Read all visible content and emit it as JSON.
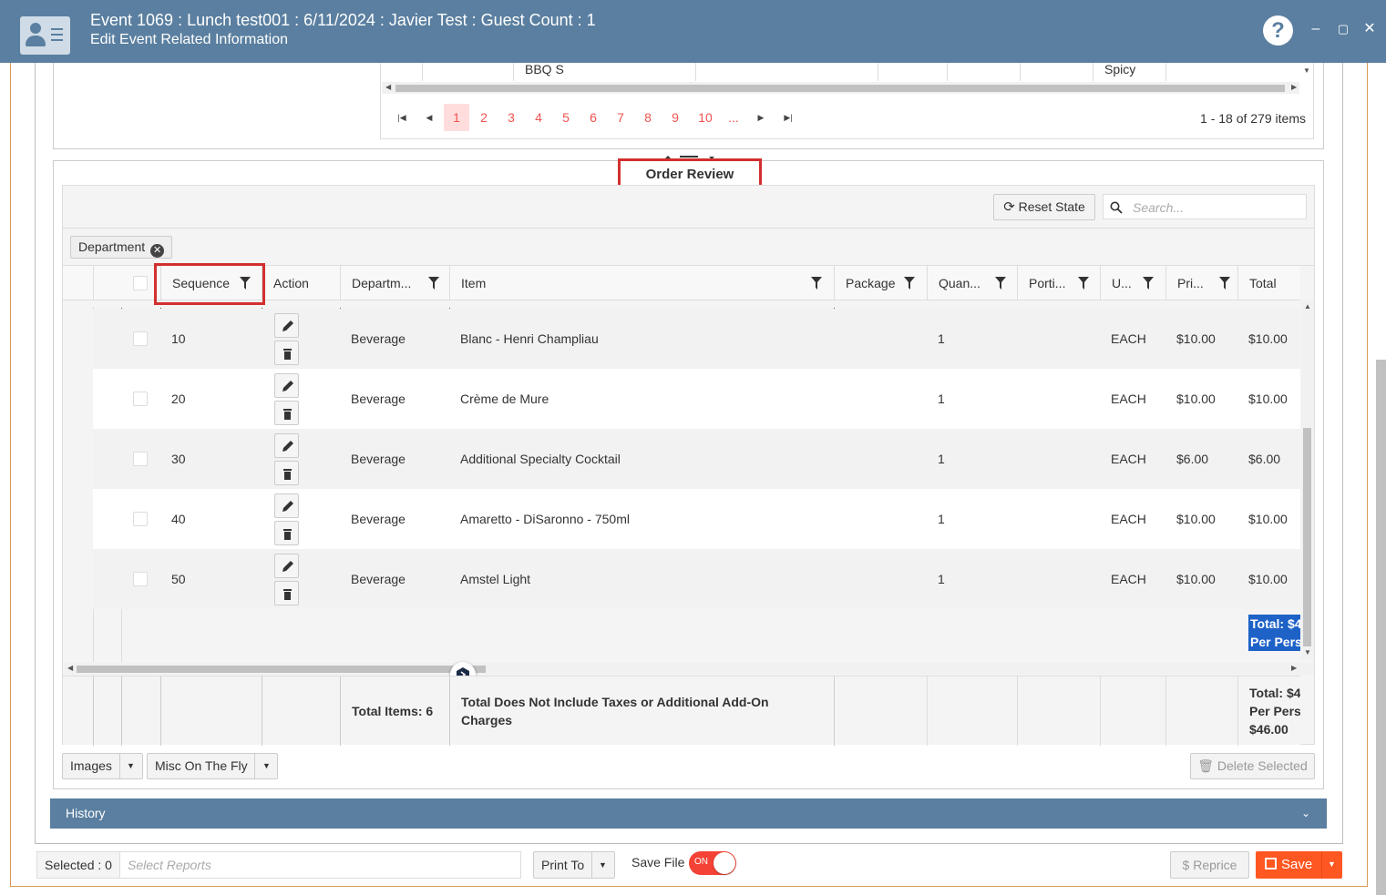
{
  "window": {
    "title": "Event 1069 : Lunch test001 : 6/11/2024 : Javier Test : Guest Count : 1",
    "subtitle": "Edit Event Related Information",
    "help_label": "?",
    "minimize": "–",
    "maximize": "▢",
    "close": "✕"
  },
  "top_grid": {
    "row": {
      "item": "BBQ S",
      "note": "Spicy"
    },
    "pager": {
      "pages": [
        "1",
        "2",
        "3",
        "4",
        "5",
        "6",
        "7",
        "8",
        "9",
        "10",
        "..."
      ],
      "active_page": "1",
      "info": "1 - 18 of 279 items"
    }
  },
  "order_review": {
    "title": "Order Review",
    "reset_state_label": "Reset State",
    "search_placeholder": "Search...",
    "group_chip": "Department",
    "columns": {
      "sequence": "Sequence",
      "action": "Action",
      "department": "Departm...",
      "item": "Item",
      "package": "Package",
      "quantity": "Quan...",
      "portion": "Porti...",
      "unit": "U...",
      "price": "Pri...",
      "total": "Total"
    },
    "rows": [
      {
        "sequence": "10",
        "department": "Beverage",
        "item": "Blanc - Henri Champliau",
        "quantity": "1",
        "unit": "EACH",
        "price": "$10.00",
        "total": "$10.00"
      },
      {
        "sequence": "20",
        "department": "Beverage",
        "item": "Crème de Mure",
        "quantity": "1",
        "unit": "EACH",
        "price": "$10.00",
        "total": "$10.00"
      },
      {
        "sequence": "30",
        "department": "Beverage",
        "item": "Additional Specialty Cocktail",
        "quantity": "1",
        "unit": "EACH",
        "price": "$6.00",
        "total": "$6.00"
      },
      {
        "sequence": "40",
        "department": "Beverage",
        "item": "Amaretto - DiSaronno - 750ml",
        "quantity": "1",
        "unit": "EACH",
        "price": "$10.00",
        "total": "$10.00"
      },
      {
        "sequence": "50",
        "department": "Beverage",
        "item": "Amstel Light",
        "quantity": "1",
        "unit": "EACH",
        "price": "$10.00",
        "total": "$10.00"
      }
    ],
    "group_total_line1": "Total: $4",
    "group_total_line2": "Per Pers",
    "footer": {
      "total_items": "Total Items: 6",
      "note": "Total Does Not Include Taxes or Additional Add-On Charges",
      "total_line1": "Total: $4",
      "total_line2": "Per Pers",
      "total_line3": "$46.00"
    },
    "images_label": "Images",
    "misc_label": "Misc On The Fly",
    "delete_selected_label": "Delete Selected"
  },
  "history": {
    "label": "History"
  },
  "bottom": {
    "selected": "Selected : 0",
    "select_reports_placeholder": "Select Reports",
    "print_to": "Print To",
    "save_file": "Save File",
    "toggle_on": "ON",
    "reprice": "Reprice",
    "save": "Save"
  },
  "colors": {
    "header": "#5a7fa0",
    "accent_red": "#d32f2f",
    "save": "#ff5722",
    "pager": "#ef5350"
  }
}
